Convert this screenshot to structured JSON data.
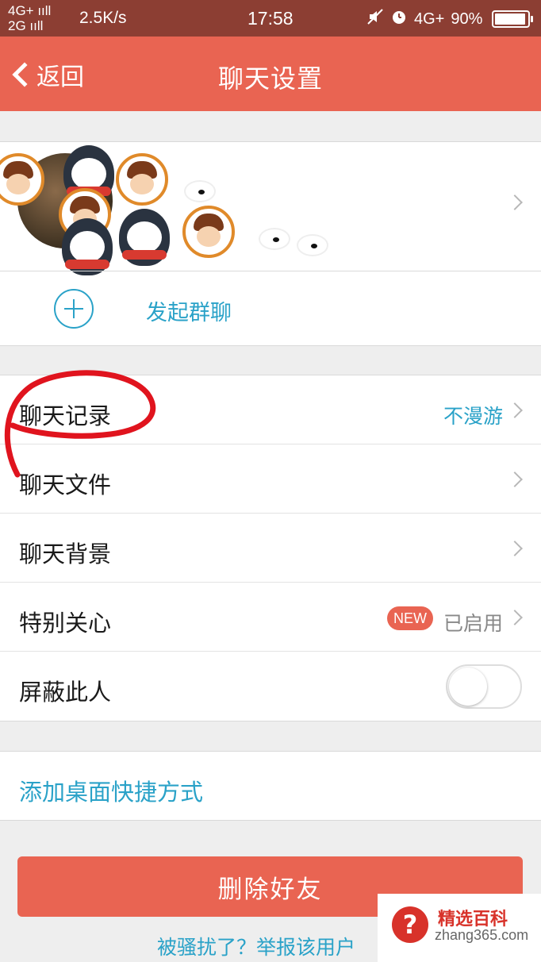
{
  "status_bar": {
    "network_top": "4G+ ııll",
    "network_bottom": "2G ııll",
    "speed": "2.5K/s",
    "time": "17:58",
    "right_network": "4G+",
    "battery": "90%"
  },
  "nav": {
    "back_label": "返回",
    "title": "聊天设置"
  },
  "profile": {
    "start_group_chat_label": "发起群聊"
  },
  "settings": [
    {
      "label": "聊天记录",
      "value": "不漫游",
      "value_style": "blue",
      "has_chevron": true
    },
    {
      "label": "聊天文件",
      "value": "",
      "has_chevron": true
    },
    {
      "label": "聊天背景",
      "value": "",
      "has_chevron": true
    },
    {
      "label": "特别关心",
      "badge": "NEW",
      "value": "已启用",
      "has_chevron": true
    },
    {
      "label": "屏蔽此人",
      "toggle_on": false
    }
  ],
  "shortcut_label": "添加桌面快捷方式",
  "delete_button_label": "删除好友",
  "report_link": "被骚扰了？举报该用户",
  "watermark": {
    "brand": "精选百科",
    "url": "zhang365.com",
    "icon": "?"
  },
  "colors": {
    "nav_bar": "#e96452",
    "status_bar": "#8c3e33",
    "accent_blue": "#2aa2c8",
    "delete_button": "#e96452",
    "annotation_red": "#e0141e"
  }
}
